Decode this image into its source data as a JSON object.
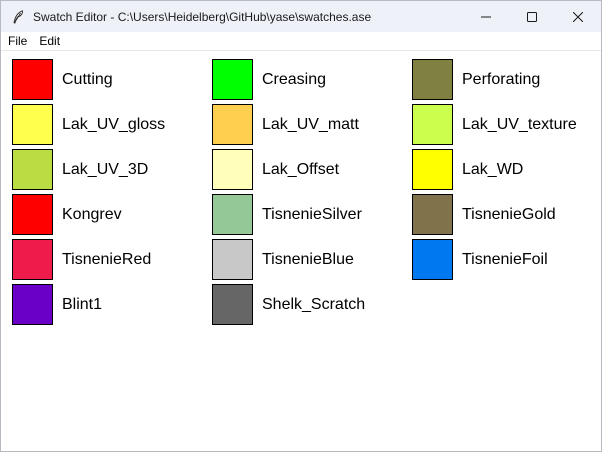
{
  "window": {
    "title": "Swatch Editor - C:\\Users\\Heidelberg\\GitHub\\yase\\swatches.ase"
  },
  "menu": {
    "items": [
      {
        "label": "File"
      },
      {
        "label": "Edit"
      }
    ]
  },
  "swatches": [
    {
      "name": "Cutting",
      "color": "#ff0000"
    },
    {
      "name": "Creasing",
      "color": "#00ff00"
    },
    {
      "name": "Perforating",
      "color": "#808040"
    },
    {
      "name": "Lak_UV_gloss",
      "color": "#ffff4d"
    },
    {
      "name": "Lak_UV_matt",
      "color": "#ffd050"
    },
    {
      "name": "Lak_UV_texture",
      "color": "#ccff4d"
    },
    {
      "name": "Lak_UV_3D",
      "color": "#bbdd44"
    },
    {
      "name": "Lak_Offset",
      "color": "#ffffbb"
    },
    {
      "name": "Lak_WD",
      "color": "#ffff00"
    },
    {
      "name": "Kongrev",
      "color": "#ff0000"
    },
    {
      "name": "TisnenieSilver",
      "color": "#94c897"
    },
    {
      "name": "TisnenieGold",
      "color": "#80724a"
    },
    {
      "name": "TisnenieRed",
      "color": "#ef1c4b"
    },
    {
      "name": "TisnenieBlue",
      "color": "#c8c8c8"
    },
    {
      "name": "TisnenieFoil",
      "color": "#0078f0"
    },
    {
      "name": "Blint1",
      "color": "#6a00c8"
    },
    {
      "name": "Shelk_Scratch",
      "color": "#666666"
    }
  ]
}
